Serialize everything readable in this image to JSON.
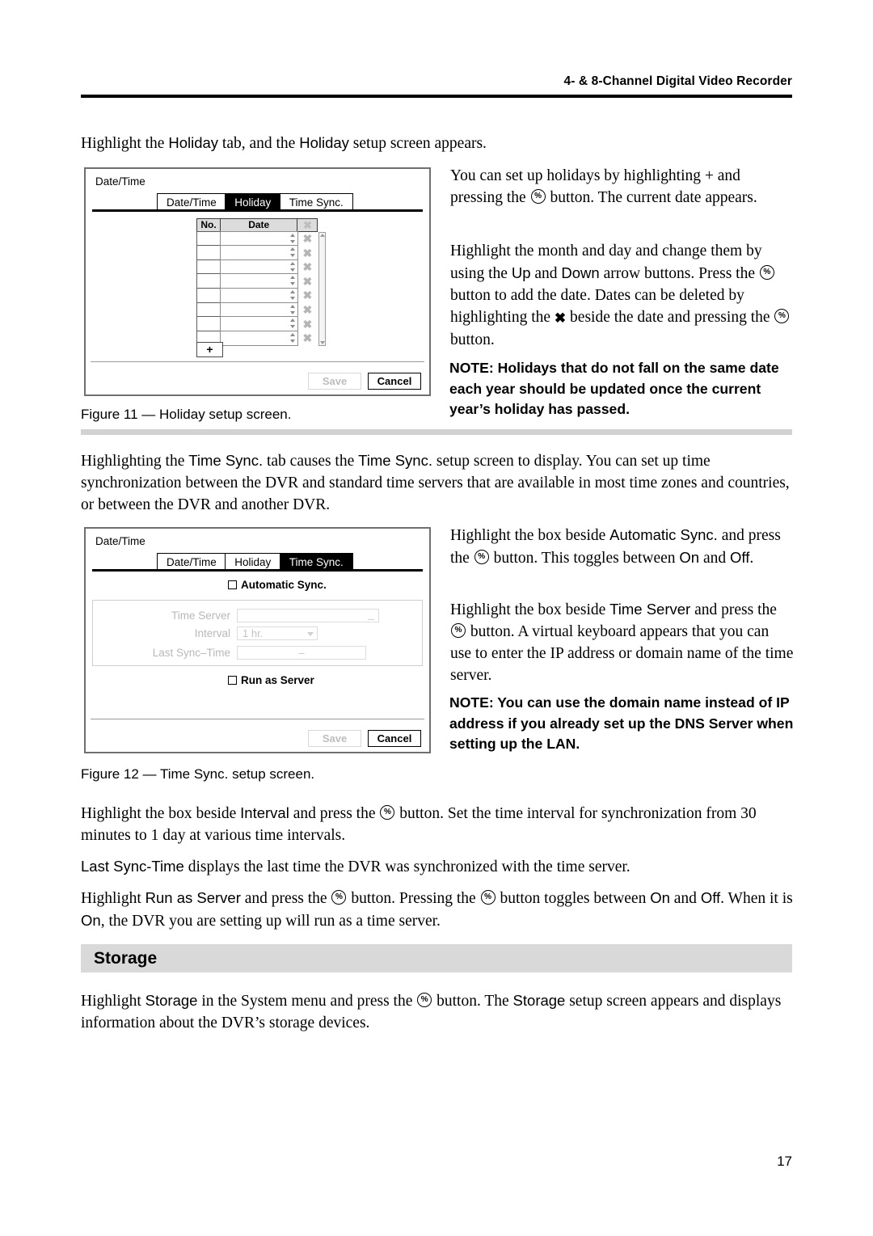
{
  "header": {
    "title": "4- & 8-Channel Digital Video Recorder"
  },
  "page_number": "17",
  "paragraphs": {
    "intro_holiday_pre": "Highlight the ",
    "intro_holiday_tab1": "Holiday",
    "intro_holiday_mid": " tab, and the ",
    "intro_holiday_tab2": "Holiday",
    "intro_holiday_post": " setup screen appears.",
    "holiday_p1_a": "You can set up holidays by highlighting + and pressing the ",
    "holiday_p1_b": " button.  The current date appears.",
    "holiday_p2_a": "Highlight the month and day and change them by using the ",
    "holiday_p2_up": "Up",
    "holiday_p2_b": " and ",
    "holiday_p2_down": "Down",
    "holiday_p2_c": " arrow buttons.  Press the ",
    "holiday_p2_d": " button to add the date.  Dates can be deleted by highlighting the ",
    "holiday_p2_e": " beside the date and pressing the ",
    "holiday_p2_f": " button.",
    "note1": "NOTE:  Holidays that do not fall on the same date each year should be updated once the current year’s holiday has passed.",
    "figure11_caption": "Figure 11 — Holiday setup screen.",
    "timesync_intro_a": "Highlighting the ",
    "timesync_intro_tab1": "Time Sync.",
    "timesync_intro_b": " tab causes the ",
    "timesync_intro_tab2": "Time Sync.",
    "timesync_intro_c": " setup screen to display.  You can set up time synchronization between the DVR and standard time servers that are available in most time zones and countries, or between the DVR and another DVR.",
    "timesync_p1_a": "Highlight the box beside ",
    "timesync_p1_term": "Automatic Sync.",
    "timesync_p1_b": " and press the ",
    "timesync_p1_c": " button.  This toggles between ",
    "timesync_p1_on": "On",
    "timesync_p1_d": " and ",
    "timesync_p1_off": "Off",
    "timesync_p1_e": ".",
    "timesync_p2_a": "Highlight the box beside ",
    "timesync_p2_term": "Time Server",
    "timesync_p2_b": " and press the ",
    "timesync_p2_c": " button.  A virtual keyboard appears that you can use to enter the IP address or domain name of the time server.",
    "note2": "NOTE:  You can use the domain name instead of IP address if you already set up the DNS Server when setting up the LAN.",
    "figure12_caption": "Figure 12 — Time Sync. setup screen.",
    "interval_p_a": "Highlight the box beside ",
    "interval_p_term": "Interval",
    "interval_p_b": " and press the ",
    "interval_p_c": " button.  Set the time interval for synchronization from 30 minutes to 1 day at various time intervals.",
    "lastsync_p_term": "Last Sync-Time",
    "lastsync_p_a": " displays the last time the DVR was synchronized with the time server.",
    "runserver_p_a": "Highlight ",
    "runserver_p_term": "Run as Server",
    "runserver_p_b": " and press the ",
    "runserver_p_c": " button.  Pressing the ",
    "runserver_p_d": " button toggles between ",
    "runserver_p_on": "On",
    "runserver_p_e": " and ",
    "runserver_p_off": "Off",
    "runserver_p_f": ".  When it is ",
    "runserver_p_on2": "On",
    "runserver_p_g": ", the DVR you are setting up will run as a time server.",
    "storage_heading": "Storage",
    "storage_p_a": "Highlight ",
    "storage_p_term1": "Storage",
    "storage_p_b": " in the System menu and press the ",
    "storage_p_c": " button.  The ",
    "storage_p_term2": "Storage",
    "storage_p_d": " setup screen appears and displays information about the DVR’s storage devices."
  },
  "figure_holiday": {
    "dialog_title": "Date/Time",
    "tabs": [
      {
        "label": "Date/Time",
        "active": false
      },
      {
        "label": "Holiday",
        "active": true
      },
      {
        "label": "Time Sync.",
        "active": false
      }
    ],
    "table": {
      "columns": [
        "No.",
        "Date",
        "✖"
      ],
      "rows": [
        {
          "no": "",
          "date": ""
        },
        {
          "no": "",
          "date": ""
        },
        {
          "no": "",
          "date": ""
        },
        {
          "no": "",
          "date": ""
        },
        {
          "no": "",
          "date": ""
        },
        {
          "no": "",
          "date": ""
        },
        {
          "no": "",
          "date": ""
        },
        {
          "no": "",
          "date": ""
        }
      ],
      "delete_glyph": "✖"
    },
    "add_button_label": "+",
    "save_label": "Save",
    "cancel_label": "Cancel"
  },
  "figure_timesync": {
    "dialog_title": "Date/Time",
    "tabs": [
      {
        "label": "Date/Time",
        "active": false
      },
      {
        "label": "Holiday",
        "active": false
      },
      {
        "label": "Time Sync.",
        "active": true
      }
    ],
    "automatic_sync_label": "Automatic Sync.",
    "automatic_sync_checked": false,
    "fields": [
      {
        "label": "Time Server",
        "value": ""
      },
      {
        "label": "Interval",
        "value": "1 hr."
      },
      {
        "label": "Last Sync–Time",
        "value": "–"
      }
    ],
    "run_as_server_label": "Run as Server",
    "run_as_server_checked": false,
    "save_label": "Save",
    "cancel_label": "Cancel"
  }
}
